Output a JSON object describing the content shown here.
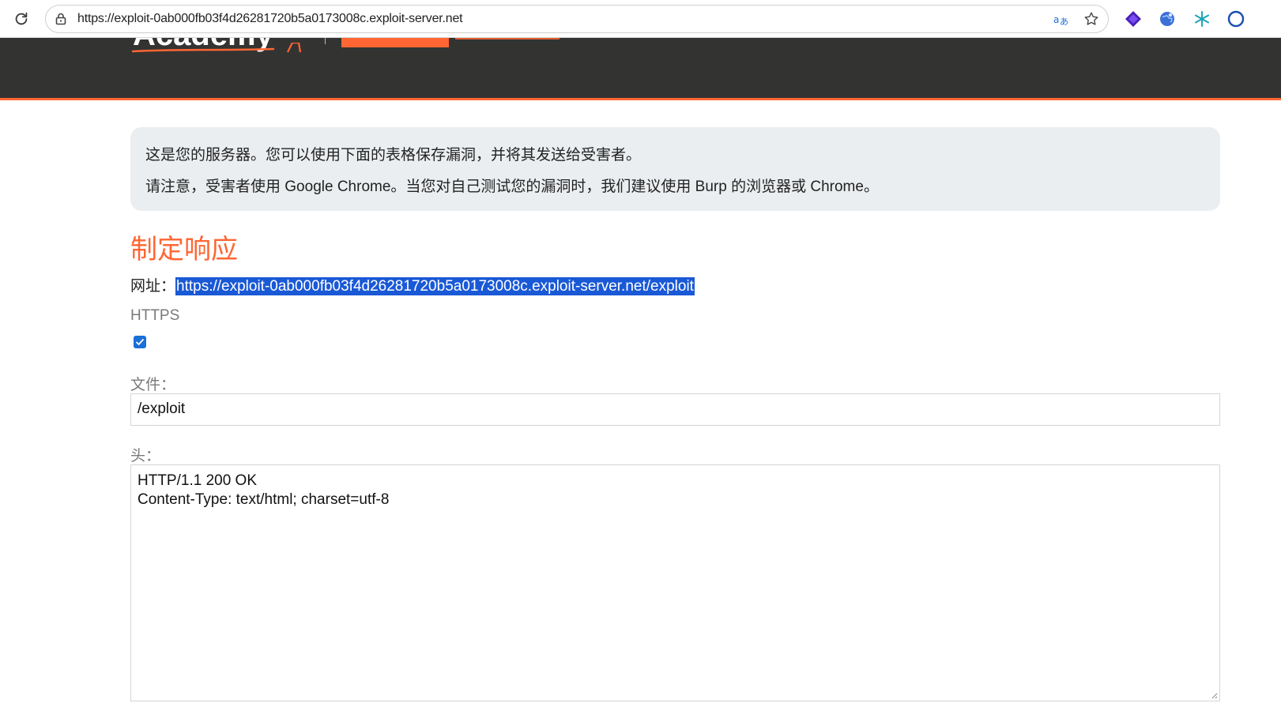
{
  "browser": {
    "address_url": "https://exploit-0ab000fb03f4d26281720b5a0173008c.exploit-server.net",
    "icons": {
      "reload": "reload-icon",
      "lock": "lock-icon",
      "translate": "translate-icon",
      "favorite": "star-icon",
      "extensions": [
        "purple-diamond-extension-icon",
        "globe-extension-icon",
        "snowflake-extension-icon",
        "profile-extension-icon"
      ]
    }
  },
  "header": {
    "logo_text": "Academy",
    "accent_color": "#ff6633",
    "background_color": "#333332"
  },
  "notice": {
    "line1": "这是您的服务器。您可以使用下面的表格保存漏洞，并将其发送给受害者。",
    "line2": "请注意，受害者使用 Google Chrome。当您对自己测试您的漏洞时，我们建议使用 Burp 的浏览器或 Chrome。"
  },
  "form": {
    "title": "制定响应",
    "url_label": "网址：",
    "url_value": "https://exploit-0ab000fb03f4d26281720b5a0173008c.exploit-server.net/exploit",
    "https_label": "HTTPS",
    "https_checked": true,
    "file_label": "文件：",
    "file_value": "/exploit",
    "head_label": "头：",
    "head_lines": [
      "HTTP/1.1 200 OK",
      "Content-Type: text/html; charset=utf-8"
    ]
  }
}
